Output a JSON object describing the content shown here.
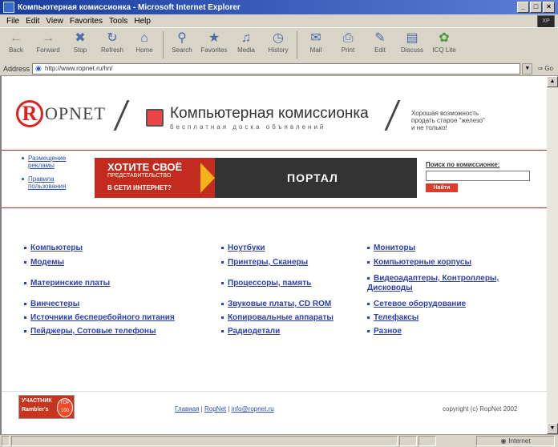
{
  "window": {
    "title": "Компьютерная комиссионка - Microsoft Internet Explorer"
  },
  "menu": [
    "File",
    "Edit",
    "View",
    "Favorites",
    "Tools",
    "Help"
  ],
  "toolbar": [
    {
      "label": "Back",
      "icon": "back-arrow-icon"
    },
    {
      "label": "Forward",
      "icon": "forward-arrow-icon"
    },
    {
      "label": "Stop",
      "icon": "stop-icon"
    },
    {
      "label": "Refresh",
      "icon": "refresh-icon"
    },
    {
      "label": "Home",
      "icon": "home-icon"
    },
    {
      "label": "Search",
      "icon": "search-icon"
    },
    {
      "label": "Favorites",
      "icon": "favorites-icon"
    },
    {
      "label": "Media",
      "icon": "media-icon"
    },
    {
      "label": "History",
      "icon": "history-icon"
    },
    {
      "label": "Mail",
      "icon": "mail-icon"
    },
    {
      "label": "Print",
      "icon": "print-icon"
    },
    {
      "label": "Edit",
      "icon": "edit-icon"
    },
    {
      "label": "Discuss",
      "icon": "discuss-icon"
    },
    {
      "label": "ICQ Lite",
      "icon": "icq-icon"
    }
  ],
  "address": {
    "label": "Address",
    "url": "http://www.ropnet.ru/hn/",
    "go": "Go"
  },
  "site": {
    "logo": "OPNET",
    "logo_letter": "R",
    "name": "Компьютерная комиссионка",
    "subtitle": "бесплатная доска объявлений",
    "slogan": [
      "Хорошая возможность",
      "продать старое \"железо\"",
      "и не только!"
    ]
  },
  "leftlinks": [
    [
      "Размещение",
      "рекламы"
    ],
    [
      "Правила",
      "пользования"
    ]
  ],
  "banner": {
    "line1": "ХОТИТЕ СВОЁ",
    "line2": [
      "ПРЕДСТАВИТЕЛЬСТВО",
      "В СЕТИ ИНТЕРНЕТ?"
    ],
    "portal": "ПОРТАЛ"
  },
  "search": {
    "label": "Поиск по комиссионке:",
    "value": "",
    "button": "Найти"
  },
  "categories": {
    "col1": [
      "Компьютеры",
      "Модемы",
      "Материнские платы",
      "Винчестеры",
      "Источники бесперебойного питания",
      "Пейджеры, Сотовые телефоны"
    ],
    "col2": [
      "Ноутбуки",
      "Принтеры, Сканеры",
      "Процессоры, память",
      "Звуковые платы, CD ROM",
      "Копировальные аппараты",
      "Радиодетали"
    ],
    "col3": [
      "Мониторы",
      "Компьютерные корпусы",
      "Видеоадаптеры, Контроллеры, Дисководы",
      "Сетевое оборудование",
      "Телефаксы",
      "Разное"
    ]
  },
  "footer": {
    "badge": [
      "УЧАСТНИК",
      "Rambler's",
      "TOP",
      "100"
    ],
    "links": [
      "Главная",
      "RopNet",
      "info@ropnet.ru"
    ],
    "copyright": "copyright (c) RopNet 2002"
  },
  "status": {
    "zone": "Internet"
  }
}
